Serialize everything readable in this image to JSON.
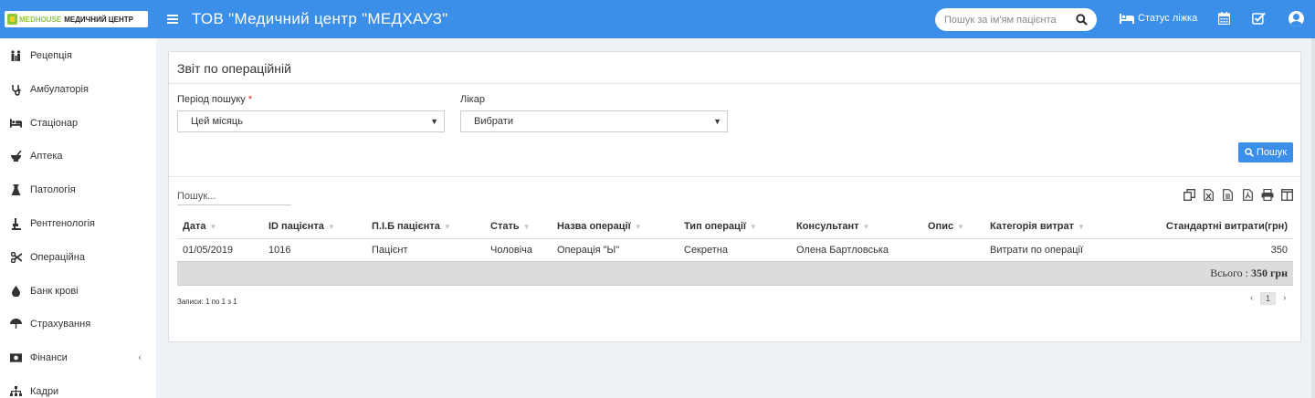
{
  "header": {
    "logo_brand": "MEDHOUSE",
    "logo_text": "МЕДИЧНИЙ ЦЕНТР",
    "title": "ТОВ \"Медичний центр \"МЕДХАУЗ\"",
    "search_placeholder": "Пошук за ім'ям пацієнта",
    "bed_status": "Статус ліжка",
    "icons": [
      "menu-icon",
      "search-icon",
      "bed-icon",
      "calendar-icon",
      "checkbox-icon",
      "user-avatar"
    ]
  },
  "sidebar": {
    "items": [
      {
        "label": "Рецепція",
        "icon": "reception-icon"
      },
      {
        "label": "Амбулаторія",
        "icon": "stethoscope-icon"
      },
      {
        "label": "Стаціонар",
        "icon": "bed-icon"
      },
      {
        "label": "Аптека",
        "icon": "mortar-icon"
      },
      {
        "label": "Патологія",
        "icon": "flask-icon"
      },
      {
        "label": "Рентгенологія",
        "icon": "xray-icon"
      },
      {
        "label": "Операційна",
        "icon": "scissors-icon"
      },
      {
        "label": "Банк крові",
        "icon": "blood-drop-icon"
      },
      {
        "label": "Страхування",
        "icon": "umbrella-icon"
      },
      {
        "label": "Фінанси",
        "icon": "money-icon",
        "chevron": "‹"
      },
      {
        "label": "Кадри",
        "icon": "org-chart-icon"
      }
    ]
  },
  "report": {
    "title": "Звіт по операційній",
    "period_label": "Період пошуку",
    "period_required": "*",
    "period_value": "Цей місяць",
    "doctor_label": "Лікар",
    "doctor_value": "Вибрати",
    "search_button": "Пошук",
    "filter_placeholder": "Пошук...",
    "export_icons": [
      "copy-icon",
      "excel-icon",
      "csv-icon",
      "pdf-icon",
      "print-icon",
      "columns-icon"
    ]
  },
  "table": {
    "columns": [
      "Дата",
      "ID пацієнта",
      "П.І.Б пацієнта",
      "Стать",
      "Назва операції",
      "Тип операції",
      "Консультант",
      "Опис",
      "Категорія витрат",
      "Стандартні витрати(грн)"
    ],
    "rows": [
      [
        "01/05/2019",
        "1016",
        "Пацієнт",
        "Чоловіча",
        "Операція \"Ы\"",
        "Секретна",
        "Олена Бартловська",
        "",
        "Витрати по операції",
        "350"
      ]
    ],
    "total_label": "Всього : ",
    "total_value": "350 грн"
  },
  "pagination": {
    "info": "Записи: 1 по 1 з 1",
    "prev": "‹",
    "current": "1",
    "next": "›"
  }
}
